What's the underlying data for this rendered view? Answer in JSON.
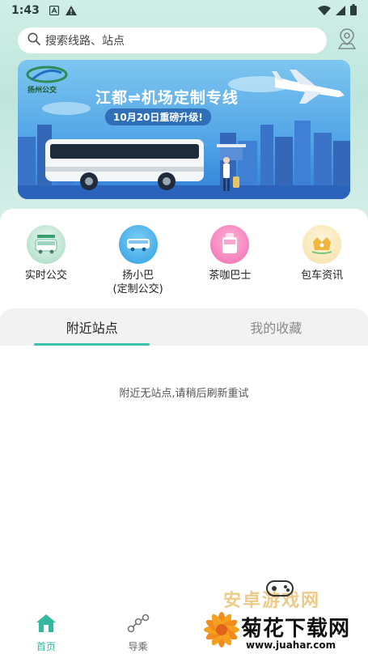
{
  "status_bar": {
    "time": "1:43",
    "icons": [
      "a-icon",
      "warning-icon",
      "wifi-icon",
      "signal-icon",
      "battery-icon"
    ]
  },
  "search": {
    "placeholder": "搜索线路、站点"
  },
  "banner": {
    "logo_text": "扬州公交",
    "title": "江都⇌机场定制专线",
    "subtitle": "10月20日重磅升级!"
  },
  "quick_actions": [
    {
      "label": "实时公交",
      "icon": "realtime-bus-icon"
    },
    {
      "label": "扬小巴\n(定制公交)",
      "icon": "yangxiaoba-icon"
    },
    {
      "label": "茶咖巴士",
      "icon": "tea-coffee-bus-icon"
    },
    {
      "label": "包车资讯",
      "icon": "charter-info-icon"
    }
  ],
  "tabs": [
    {
      "label": "附近站点",
      "active": true
    },
    {
      "label": "我的收藏",
      "active": false
    }
  ],
  "empty_message": "附近无站点,请稍后刷新重试",
  "bottom_nav": [
    {
      "label": "首页",
      "icon": "home-icon",
      "active": true
    },
    {
      "label": "导乘",
      "icon": "route-guide-icon",
      "active": false
    }
  ],
  "watermark": {
    "faded_text": "安卓游戏网",
    "main_text": "菊花下载网",
    "url": "www.juahar.com"
  },
  "colors": {
    "accent": "#3cc2a8",
    "nav_active": "#34b89e",
    "banner_blue": "#4fa3e6"
  }
}
